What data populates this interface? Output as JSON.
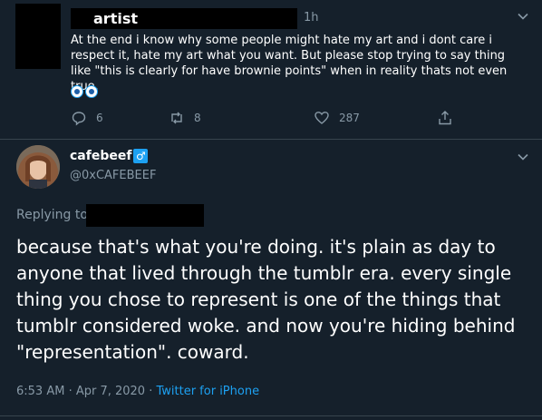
{
  "parent_tweet": {
    "name": "artist",
    "time": "1h",
    "text": "At the end i know why some people might hate my art and i dont care i respect it, hate my art what you want. But please stop trying to say thing like \"this is clearly for have brownie points\" when in reality thats not even true.",
    "actions": {
      "replies": "6",
      "retweets": "8",
      "likes": "287"
    }
  },
  "main_tweet": {
    "name": "cafebeef",
    "badge": "♂",
    "handle": "@0xCAFEBEEF",
    "replying_to": "Replying to",
    "text": "because that's what you're doing. it's plain as day to anyone that lived through the tumblr era. every single thing you chose to represent is one of the things that tumblr considered woke. and now you're hiding behind \"representation\". coward.",
    "timestamp": "6:53 AM · Apr 7, 2020 · ",
    "client": "Twitter for iPhone"
  },
  "colors": {
    "background": "#15202b",
    "secondary_text": "#8899a6",
    "accent": "#1da1f2",
    "divider": "#38444d"
  }
}
